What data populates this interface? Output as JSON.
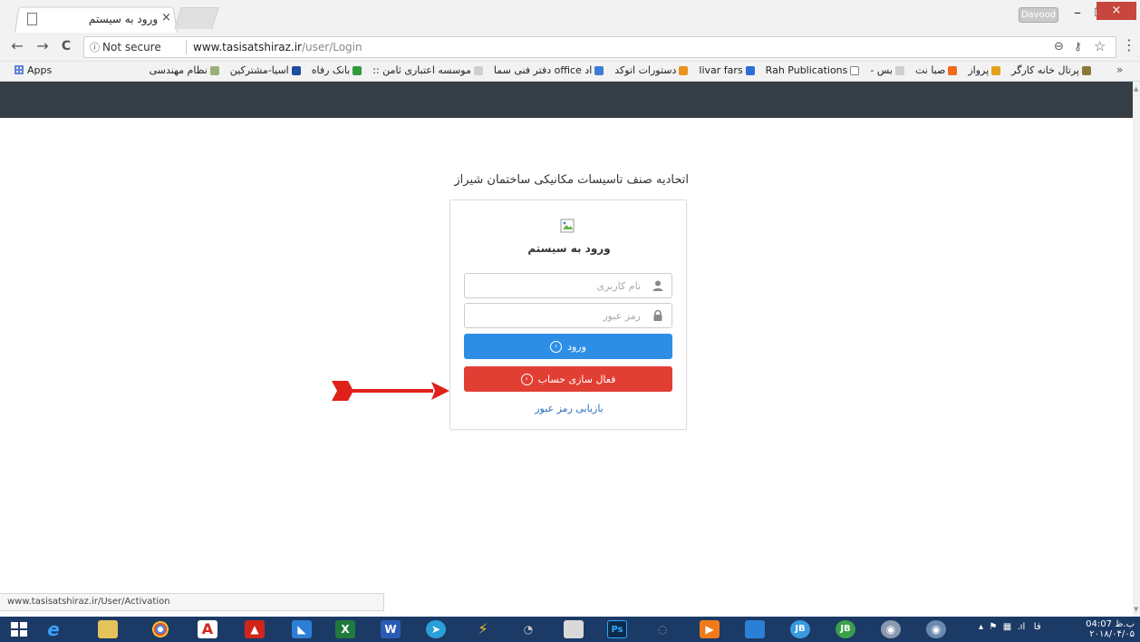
{
  "browser": {
    "tab_title": "ورود به سیستم",
    "tab_close": "×",
    "profile_name": "Davood",
    "window_min": "–",
    "window_max": "❐",
    "window_close": "×",
    "nav_back": "←",
    "nav_forward": "→",
    "nav_reload": "C",
    "security_icon": "ⓘ",
    "security_label": "Not secure",
    "url_host": "www.tasisatshiraz.ir",
    "url_path": "/user/Login",
    "zoom_icon": "⊖",
    "key_icon": "⚷",
    "star_icon": "☆",
    "menu_icon": "⋮"
  },
  "bookmarks": {
    "apps_label": "Apps",
    "more": "»",
    "items": [
      {
        "label": "پرتال خانه کارگر",
        "color": "#8a7a3a"
      },
      {
        "label": "پرواز",
        "color": "#e3a21a"
      },
      {
        "label": "صبا نت",
        "color": "#f26b1d"
      },
      {
        "label": "- بس",
        "color": "#cfcfcf"
      },
      {
        "label": "Rah Publications",
        "color": "#ffffff"
      },
      {
        "label": "livar fars",
        "color": "#2b6ed6"
      },
      {
        "label": "دستورات اتوکد",
        "color": "#e8931e"
      },
      {
        "label": "دفتر فنی سما office اد",
        "color": "#3e7bd6"
      },
      {
        "label": ":: موسسه اعتباری ثامن",
        "color": "#cfcfcf"
      },
      {
        "label": "بانک رفاه",
        "color": "#2e9a3a"
      },
      {
        "label": "اسیا-مشترکین",
        "color": "#1d4fa0"
      },
      {
        "label": "نظام مهندسی",
        "color": "#9ab07a"
      }
    ]
  },
  "page": {
    "org_title": "اتحادیه صنف تاسیسات مکانیکی ساختمان شیراز",
    "login_heading": "ورود به سیستم",
    "username_placeholder": "نام کاربری",
    "password_placeholder": "رمز عبور",
    "login_label": "ورود",
    "activate_label": "فعال سازی حساب",
    "recover_label": "بازیابی رمز عبور",
    "status_url": "www.tasisatshiraz.ir/User/Activation"
  },
  "colors": {
    "header_bar": "#363e45",
    "login_button": "#2e8ee6",
    "activate_button": "#e23f34",
    "annotation_arrow": "#e0201a",
    "taskbar": "#1c3a66"
  },
  "taskbar": {
    "clock_time": "04:07 ب.ظ",
    "clock_date": "۲۰۱۸/۰۴/۰۵",
    "lang": "فا"
  }
}
